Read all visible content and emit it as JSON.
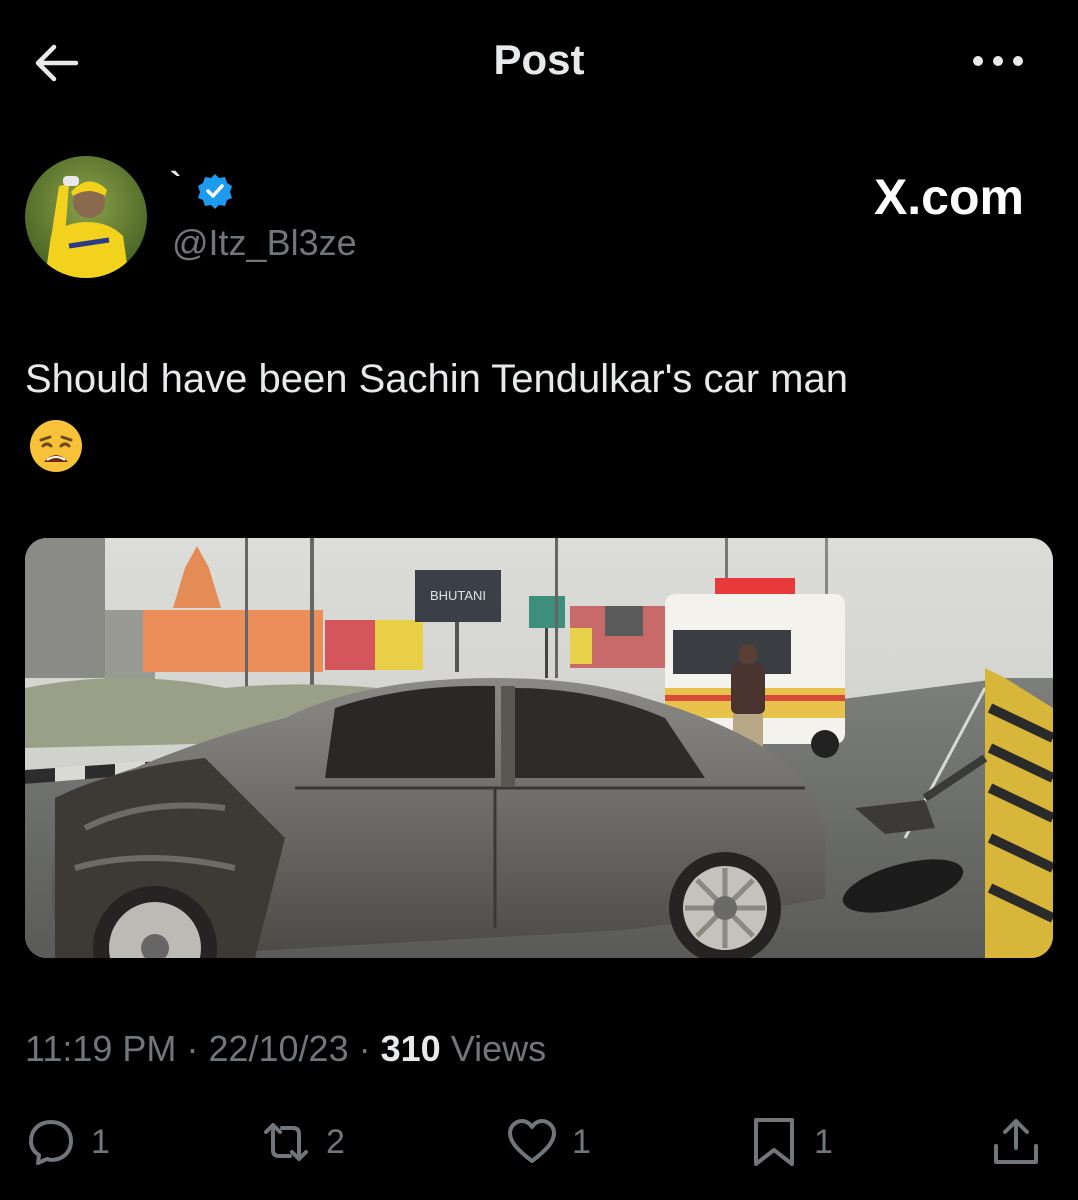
{
  "header": {
    "title": "Post",
    "back_icon": "arrow-left-icon",
    "more_icon": "more-horizontal-icon"
  },
  "author": {
    "display_name": "`",
    "handle": "@Itz_Bl3ze",
    "verified": true
  },
  "watermark": "X.com",
  "tweet": {
    "text": "Should have been Sachin Tendulkar's car man",
    "emoji": "😩"
  },
  "media": {
    "billboard_text": "BHUTANI",
    "sign_text": ""
  },
  "meta": {
    "time": "11:19 PM",
    "separator": "·",
    "date": "22/10/23",
    "views_count": "310",
    "views_label": "Views"
  },
  "actions": {
    "replies": "1",
    "reposts": "2",
    "likes": "1",
    "bookmarks": "1"
  },
  "colors": {
    "background": "#000000",
    "text": "#e7e9ea",
    "secondary": "#71767b",
    "verified": "#1d9bf0"
  }
}
